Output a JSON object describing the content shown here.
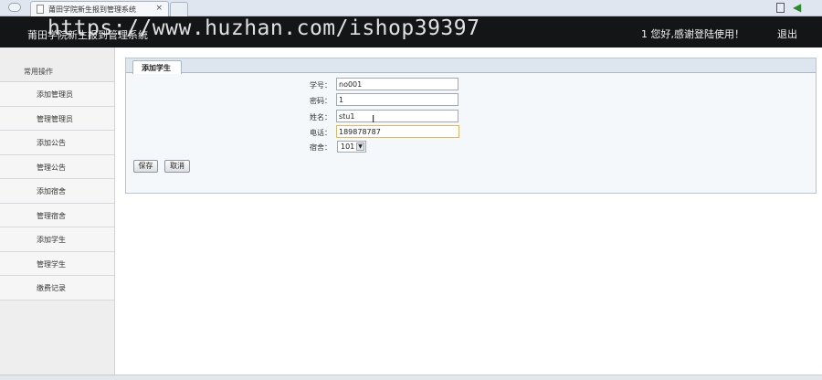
{
  "browser": {
    "tab_title": "莆田学院新生报到管理系统",
    "tab_close": "×",
    "back_arrow": "◀"
  },
  "header": {
    "title": "莆田学院新生报到管理系统",
    "watermark": "https://www.huzhan.com/ishop39397",
    "welcome": "1 您好,感谢登陆使用！",
    "logout": "退出"
  },
  "sidebar": {
    "heading": "常用操作",
    "items": [
      {
        "label": "添加管理员"
      },
      {
        "label": "管理管理员"
      },
      {
        "label": "添加公告"
      },
      {
        "label": "管理公告"
      },
      {
        "label": "添加宿舍"
      },
      {
        "label": "管理宿舍"
      },
      {
        "label": "添加学生"
      },
      {
        "label": "管理学生"
      },
      {
        "label": "缴费记录"
      }
    ]
  },
  "main": {
    "tab_label": "添加学生",
    "form": {
      "student_no_label": "学号：",
      "student_no_value": "no001",
      "password_label": "密码：",
      "password_value": "1",
      "name_label": "姓名：",
      "name_value": "stu1",
      "phone_label": "电话：",
      "phone_value": "189878787",
      "dorm_label": "宿舍：",
      "dorm_value": "101",
      "dorm_arrow": "▼"
    },
    "save_label": "保存",
    "cancel_label": "取消",
    "cursor_glyph": "I"
  }
}
